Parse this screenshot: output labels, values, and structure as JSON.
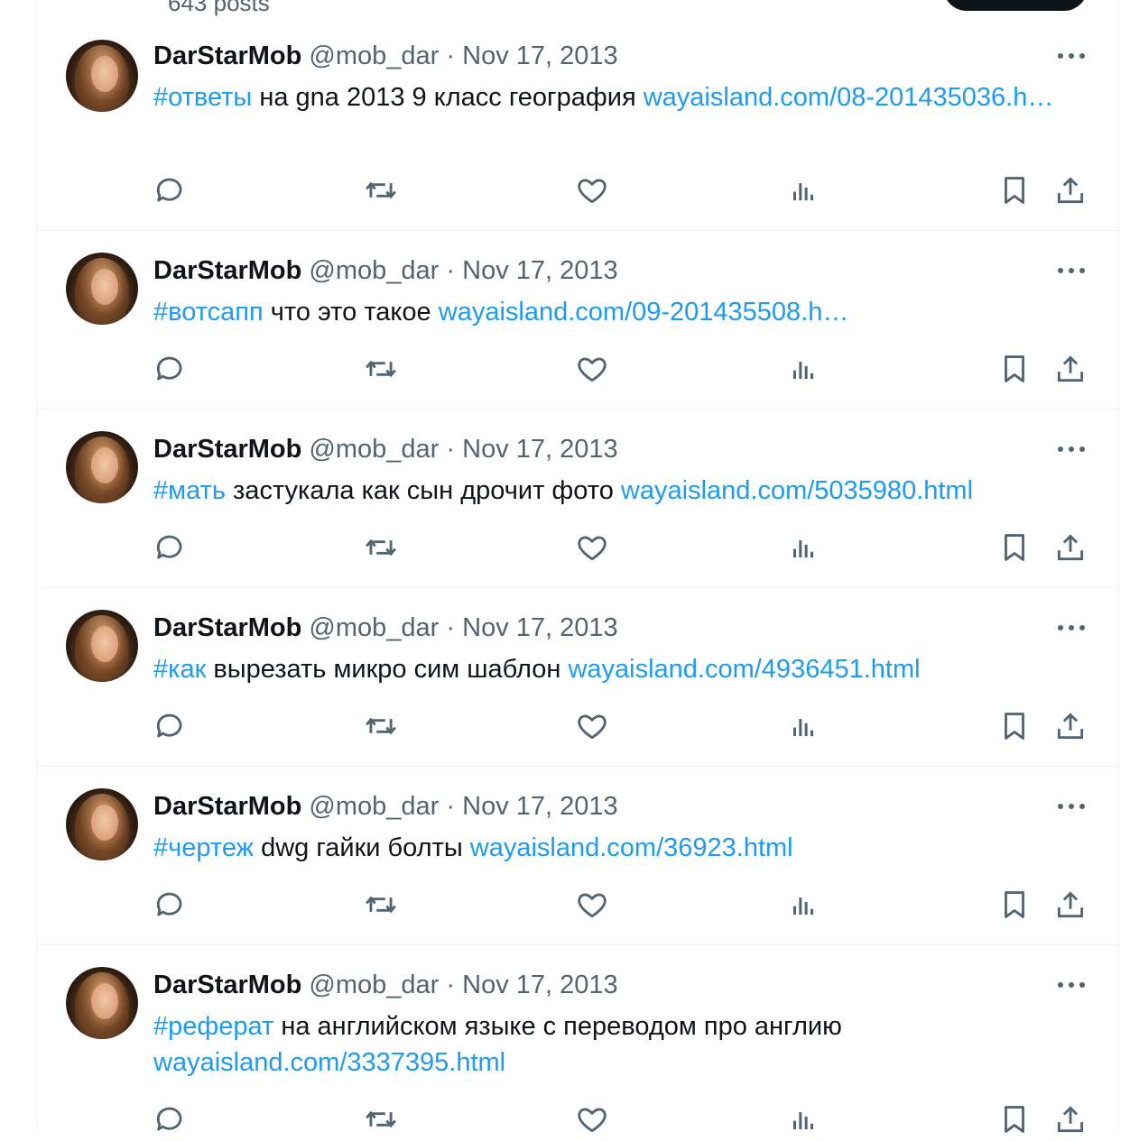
{
  "profile": {
    "post_count": "643 posts"
  },
  "tweets": [
    {
      "name": "DarStarMob",
      "handle": "@mob_dar",
      "separator": "·",
      "date": "Nov 17, 2013",
      "hashtag": "#ответы",
      "text": "на gna 2013 9 класс география",
      "link": "wayaisland.com/08-201435036.h…"
    },
    {
      "name": "DarStarMob",
      "handle": "@mob_dar",
      "separator": "·",
      "date": "Nov 17, 2013",
      "hashtag": "#вотсапп",
      "text": "что это такое",
      "link": "wayaisland.com/09-201435508.h…"
    },
    {
      "name": "DarStarMob",
      "handle": "@mob_dar",
      "separator": "·",
      "date": "Nov 17, 2013",
      "hashtag": "#мать",
      "text": "застукала как сын дрочит фото",
      "link": "wayaisland.com/5035980.html"
    },
    {
      "name": "DarStarMob",
      "handle": "@mob_dar",
      "separator": "·",
      "date": "Nov 17, 2013",
      "hashtag": "#как",
      "text": "вырезать микро сим шаблон",
      "link": "wayaisland.com/4936451.html"
    },
    {
      "name": "DarStarMob",
      "handle": "@mob_dar",
      "separator": "·",
      "date": "Nov 17, 2013",
      "hashtag": "#чертеж",
      "text": "dwg гайки болты",
      "link": "wayaisland.com/36923.html"
    },
    {
      "name": "DarStarMob",
      "handle": "@mob_dar",
      "separator": "·",
      "date": "Nov 17, 2013",
      "hashtag": "#реферат",
      "text": "на английском языке с переводом про англию",
      "link": "wayaisland.com/3337395.html"
    }
  ],
  "icons": {
    "reply": "reply-icon",
    "retweet": "retweet-icon",
    "like": "like-icon",
    "views": "views-icon",
    "bookmark": "bookmark-icon",
    "share": "share-icon",
    "more": "more-icon"
  },
  "colors": {
    "link": "#1d9bf0",
    "muted": "#536471",
    "text": "#0f1419",
    "border": "#eff3f4"
  }
}
